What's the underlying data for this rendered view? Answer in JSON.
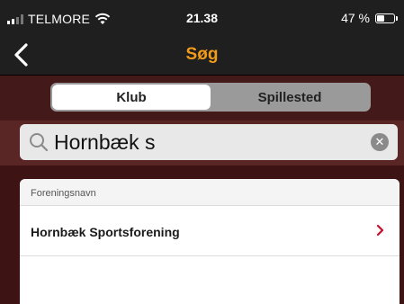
{
  "status": {
    "carrier": "TELMORE",
    "time": "21.38",
    "battery_text": "47 %",
    "battery_level": 0.47
  },
  "nav": {
    "title": "Søg",
    "back_icon": "chevron-left-icon"
  },
  "segments": [
    {
      "label": "Klub",
      "active": true
    },
    {
      "label": "Spillested",
      "active": false
    }
  ],
  "search": {
    "value": "Hornbæk s",
    "search_icon": "search-icon",
    "clear_icon": "clear-icon"
  },
  "results": {
    "section_header": "Foreningsnavn",
    "items": [
      {
        "label": "Hornbæk Sportsforening",
        "chevron_icon": "chevron-right-icon"
      }
    ]
  },
  "colors": {
    "accent": "#f29b1a",
    "chevron": "#c8102e",
    "background": "#431a19"
  }
}
